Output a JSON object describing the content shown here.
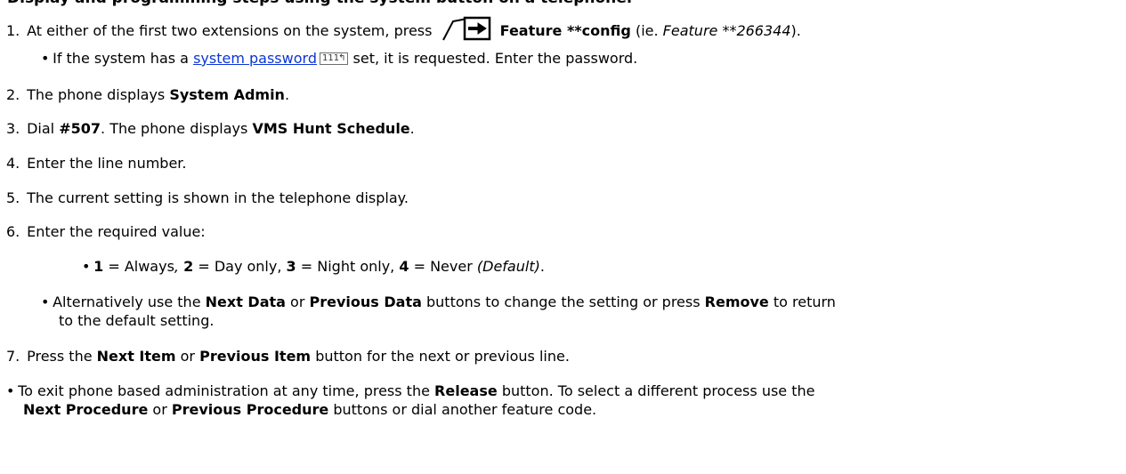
{
  "top_cut": "Display and programming steps using the system button on a telephone.",
  "step1": {
    "num": "1.",
    "pre": "At either of the first two extensions on the system, press",
    "bold": "Feature **config",
    "mid": "(ie.",
    "italic": "Feature **266344",
    "post": ")."
  },
  "bullet1": {
    "pre": "If the system has a",
    "link": "system password",
    "ref": "111",
    "post": "set, it is requested. Enter the password."
  },
  "step2": {
    "num": "2.",
    "pre": "The phone displays",
    "bold": "System Admin",
    "post": "."
  },
  "step3": {
    "num": "3.",
    "pre": "Dial",
    "bold": "#507",
    "mid": ". The phone displays",
    "bold2": "VMS Hunt Schedule",
    "post": "."
  },
  "step4": {
    "num": "4.",
    "text": "Enter the line number."
  },
  "step5": {
    "num": "5.",
    "text": "The current setting is shown in the telephone display."
  },
  "step6": {
    "num": "6.",
    "text": "Enter the required value:"
  },
  "values": {
    "v1": "1",
    "t1": "= Always",
    "sep1": ",",
    "v2": "2",
    "t2": "= Day only,",
    "v3": "3",
    "t3": "= Night only,",
    "v4": "4",
    "t4": "= Never",
    "default": "(Default)",
    "end": "."
  },
  "bullet2": {
    "pre": "Alternatively use the",
    "b1": "Next Data",
    "or": "or",
    "b2": "Previous Data",
    "mid": "buttons to change the setting or press",
    "b3": "Remove",
    "post": "to return",
    "line2": "to the default setting."
  },
  "step7": {
    "num": "7.",
    "pre": "Press the",
    "b1": "Next Item",
    "or": "or",
    "b2": "Previous Item",
    "post": "button for the next or previous line."
  },
  "bullet3": {
    "pre": "To exit phone based administration at any time, press the",
    "b1": "Release",
    "mid": "button. To select a different process use the",
    "b2": "Next Procedure",
    "or": "or",
    "b3": "Previous Procedure",
    "post": "buttons or dial another feature code."
  }
}
